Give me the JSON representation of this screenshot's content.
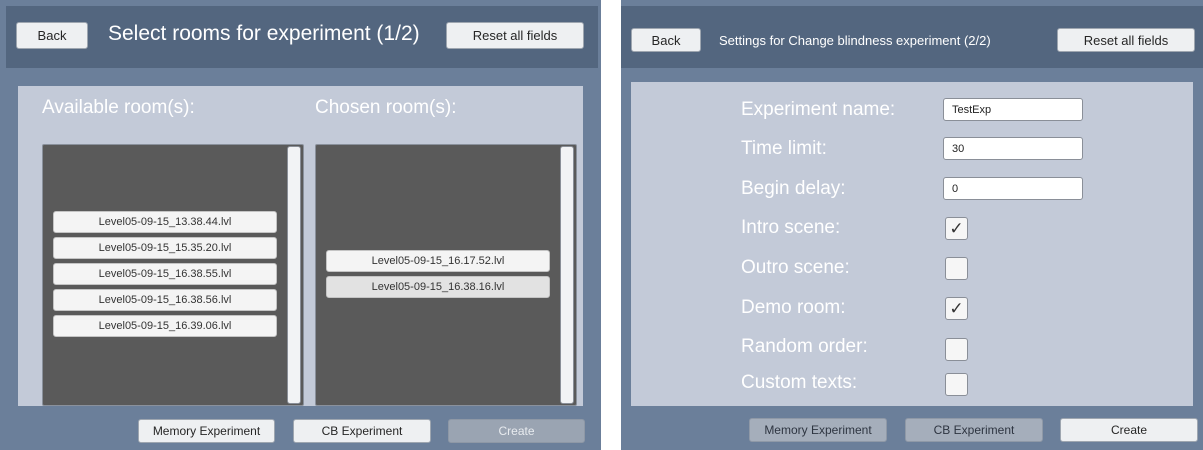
{
  "screen1": {
    "back_label": "Back",
    "title": "Select rooms for experiment (1/2)",
    "reset_label": "Reset all fields",
    "available_title": "Available room(s):",
    "chosen_title": "Chosen room(s):",
    "available_rooms": [
      "Level05-09-15_13.38.44.lvl",
      "Level05-09-15_15.35.20.lvl",
      "Level05-09-15_16.38.55.lvl",
      "Level05-09-15_16.38.56.lvl",
      "Level05-09-15_16.39.06.lvl"
    ],
    "chosen_rooms": [
      "Level05-09-15_16.17.52.lvl",
      "Level05-09-15_16.38.16.lvl"
    ],
    "footer": {
      "memory_label": "Memory Experiment",
      "cb_label": "CB Experiment",
      "create_label": "Create"
    }
  },
  "screen2": {
    "back_label": "Back",
    "title": "Settings for Change blindness experiment (2/2)",
    "reset_label": "Reset all fields",
    "fields": {
      "experiment_name": {
        "label": "Experiment name:",
        "value": "TestExp"
      },
      "time_limit": {
        "label": "Time limit:",
        "value": "30"
      },
      "begin_delay": {
        "label": "Begin delay:",
        "value": "0"
      }
    },
    "toggles": {
      "intro_scene": {
        "label": "Intro scene:",
        "checked": true
      },
      "outro_scene": {
        "label": "Outro scene:",
        "checked": false
      },
      "demo_room": {
        "label": "Demo room:",
        "checked": true
      },
      "random_order": {
        "label": "Random order:",
        "checked": false
      },
      "custom_texts": {
        "label": "Custom texts:",
        "checked": false
      }
    },
    "footer": {
      "memory_label": "Memory Experiment",
      "cb_label": "CB Experiment",
      "create_label": "Create"
    }
  },
  "icons": {
    "checkmark": "✓"
  }
}
